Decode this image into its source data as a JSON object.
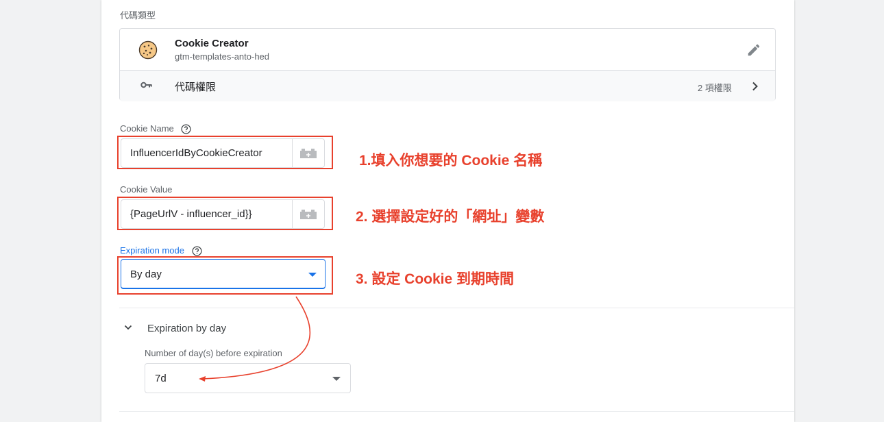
{
  "tag_type": {
    "section_label": "代碼類型",
    "name": "Cookie Creator",
    "template_id": "gtm-templates-anto-hed",
    "permissions_label": "代碼權限",
    "permissions_count": "2 項權限",
    "icons": {
      "template": "cookie-icon",
      "edit": "edit-pencil-icon",
      "permissions": "key-icon",
      "more": "chevron-right-icon"
    }
  },
  "fields": {
    "cookie_name": {
      "label": "Cookie Name",
      "value": "InfluencerIdByCookieCreator"
    },
    "cookie_value": {
      "label": "Cookie Value",
      "value": "{PageUrlV - influencer_id}}"
    },
    "expiration_mode": {
      "label": "Expiration mode",
      "selected": "By day"
    }
  },
  "annotations": {
    "step1": "1.填入你想要的 Cookie 名稱",
    "step2": "2. 選擇設定好的「網址」變數",
    "step3": "3. 設定 Cookie 到期時間",
    "color": "#e8412d"
  },
  "expiration_by_day": {
    "header": "Expiration by day",
    "days_label": "Number of day(s) before expiration",
    "days_value": "7d"
  },
  "colors": {
    "accent": "#1a73e8",
    "annotation_red": "#e8412d",
    "background": "#f1f2f3"
  }
}
